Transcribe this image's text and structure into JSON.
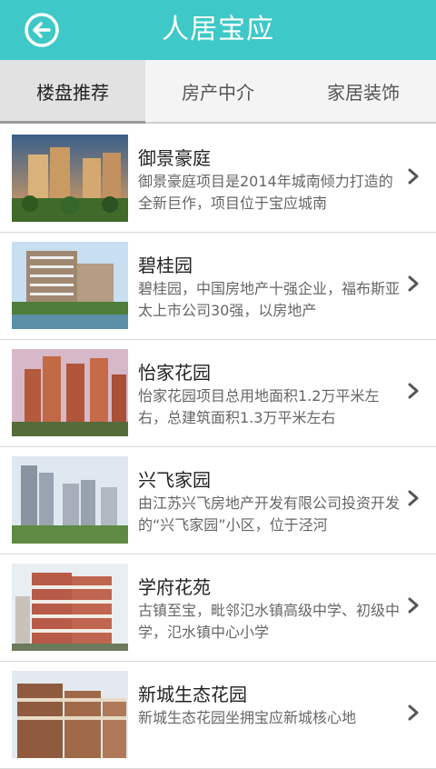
{
  "header": {
    "title": "人居宝应",
    "back_icon": "back-arrow-circle-icon"
  },
  "tabs": [
    {
      "label": "楼盘推荐",
      "active": true
    },
    {
      "label": "房产中介",
      "active": false
    },
    {
      "label": "家居装饰",
      "active": false
    }
  ],
  "listings": [
    {
      "title": "御景豪庭",
      "desc": "御景豪庭项目是2014年城南倾力打造的全新巨作，项目位于宝应城南"
    },
    {
      "title": "碧桂园",
      "desc": "碧桂园，中国房地产十强企业，福布斯亚太上市公司30强，以房地产"
    },
    {
      "title": "怡家花园",
      "desc": "怡家花园项目总用地面积1.2万平米左右，总建筑面积1.3万平米左右"
    },
    {
      "title": "兴飞家园",
      "desc": "由江苏兴飞房地产开发有限公司投资开发的“兴飞家园”小区，位于泾河"
    },
    {
      "title": "学府花苑",
      "desc": "古镇至宝，毗邻氾水镇高级中学、初级中学，氾水镇中心小学"
    },
    {
      "title": "新城生态花园",
      "desc": "新城生态花园坐拥宝应新城核心地"
    }
  ]
}
